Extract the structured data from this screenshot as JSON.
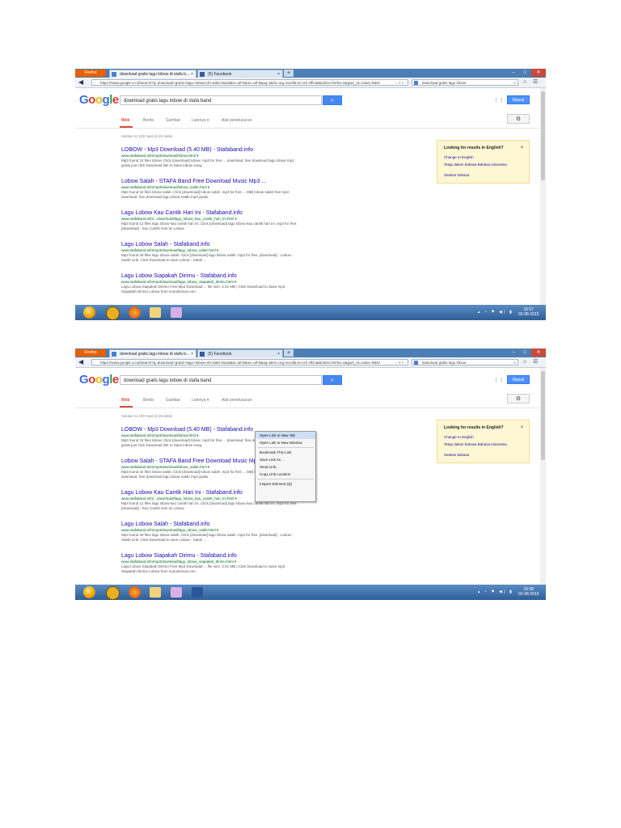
{
  "screens": [
    {
      "browser": {
        "firefox_label": "Firefox",
        "tabs": [
          {
            "label": "download gratis lagu lobow di stafa b...",
            "close": "×"
          },
          {
            "label": "(5) Facebook",
            "close": "×"
          }
        ],
        "new_tab": "+",
        "window_controls": {
          "minimize": "–",
          "maximize": "□",
          "close": "✕"
        },
        "url": "https://www.google.co.id/search?q=download+gratis+lagu+lobow+di+stafa+band&ie=utf-8&oe=utf-8&aq=t&rls=org.mozilla:en-US:official&client=firefox-a&gws_rd=cr&ei=R&IV",
        "search_text": "download gratis lagu lobow"
      },
      "google": {
        "query": "download gratis lagu lobow di stafa band",
        "masuk": "Masuk",
        "nav": [
          "Web",
          "Berita",
          "Gambar",
          "Lainnya ▾",
          "Alat penelusuran"
        ],
        "stats": "Sekitar 61.100 hasil (0,28 detik)",
        "results": [
          {
            "title": "LOBOW - Mp3 Download (5.40 MB) - Stafaband.info",
            "url": "www.stafaband.info/mp3/download/lobow.html ▾",
            "snippet": "Mp3 found 32 files lobow. Click [download] lobow .mp3 for free ... download, free download lagu lobow mp3 gratis.just click Download link to Save lobow song."
          },
          {
            "title": "Lobow Salah - STAFA Band Free Download Music Mp3 ...",
            "url": "www.stafaband.info/mp3/download/lobow_salah.html ▾",
            "snippet": "Mp3 found 32 files lobow salah. Click [download] lobow salah .mp3 for free ... MB] lobow salah free mp3 download, free download lagu lobow salah mp3 gratis."
          },
          {
            "title": "Lagu Lobow Kau Cantik Hari Ini - Stafaband.info",
            "url": "www.stafaband.info/.../download/lagu_lobow_kau_cantik_hari_ini.html ▾",
            "snippet": "Mp3 found 12 files lagu lobow kau cantik hari ini. Click [download] lagu lobow kau cantik hari ini .mp3 for free. [download] - Kau Cantik Hari Ini Lobow"
          },
          {
            "title": "Lagu Lobow Salah - Stafaband.info",
            "url": "www.stafaband.info/mp3/download/lagu_lobow_salah.html ▾",
            "snippet": "Mp3 found 29 files lagu lobow salah. Click [download] lagu lobow salah .mp3 for free. [download] - Lobow - Salah Lirik. Click Download to save Lobow - Salah ..."
          },
          {
            "title": "Lagu Lobow Siapakah Dirimu - Stafaband.info",
            "url": "www.stafaband.info/mp3/download/lagu_lobow_siapakah_dirimu.html ▾",
            "snippet": "Lagu Lobow Siapakah Dirimu Free Mp3 Download ... file size: 2.01 MB | Click Download to Save mp3 Siapakah Dirimu Lobow from soundcloud.com."
          }
        ],
        "lang_box": {
          "heading": "Looking for results in English?",
          "close": "✕",
          "links": [
            "Change to English",
            "Tetap dalam bahasa Bahasa Indonesia",
            "Setelan bahasa"
          ]
        }
      },
      "taskbar": {
        "time": "15:57",
        "date": "02-08-2015"
      }
    },
    {
      "browser": {
        "firefox_label": "Firefox",
        "tabs": [
          {
            "label": "download gratis lagu lobow di stafa b...",
            "close": "×"
          },
          {
            "label": "(5) Facebook",
            "close": "×"
          }
        ],
        "new_tab": "+",
        "window_controls": {
          "minimize": "–",
          "maximize": "□",
          "close": "✕"
        },
        "url": "https://www.google.co.id/search?q=download+gratis+lagu+lobow+di+stafa+band&ie=utf-8&oe=utf-8&aq=t&rls=org.mozilla:en-US:official&client=firefox-a&gws_rd=cr&ei=R&IV",
        "search_text": "download gratis lagu lobow"
      },
      "google": {
        "query": "download gratis lagu lobow di stafa band",
        "masuk": "Masuk",
        "nav": [
          "Web",
          "Berita",
          "Gambar",
          "Lainnya ▾",
          "Alat penelusuran"
        ],
        "stats": "Sekitar 61.100 hasil (0,28 detik)",
        "results": [
          {
            "title": "LOBOW - Mp3 Download (5.40 MB) - Stafaband.info",
            "url": "www.stafaband.info/mp3/download/lobow.html ▾",
            "snippet": "Mp3 found 32 files lobow. Click [download] lobow .mp3 for free ... download, free download lagu lobow mp3 gratis.just click Download link to Save lobow song."
          },
          {
            "title": "Lobow Salah - STAFA Band Free Download Music Mp3 ...",
            "url": "www.stafaband.info/mp3/download/lobow_salah.html ▾",
            "snippet": "Mp3 found 32 files lobow salah. Click [download] lobow salah .mp3 for free ... MB] lobow salah free mp3 download, free download lagu lobow salah mp3 gratis."
          },
          {
            "title": "Lagu Lobow Kau Cantik Hari Ini - Stafaband.info",
            "url": "www.stafaband.info/.../download/lagu_lobow_kau_cantik_hari_ini.html ▾",
            "snippet": "Mp3 found 12 files lagu lobow kau cantik hari ini. Click [download] lagu lobow kau cantik hari ini .mp3 for free. [download] - Kau Cantik Hari Ini Lobow"
          },
          {
            "title": "Lagu Lobow Salah - Stafaband.info",
            "url": "www.stafaband.info/mp3/download/lagu_lobow_salah.html ▾",
            "snippet": "Mp3 found 29 files lagu lobow salah. Click [download] lagu lobow salah .mp3 for free. [download] - Lobow - Salah Lirik. Click Download to save Lobow - Salah ..."
          },
          {
            "title": "Lagu Lobow Siapakah Dirimu - Stafaband.info",
            "url": "www.stafaband.info/mp3/download/lagu_lobow_siapakah_dirimu.html ▾",
            "snippet": "Lagu Lobow Siapakah Dirimu Free Mp3 Download ... file size: 2.01 MB | Click Download to Save mp3 Siapakah Dirimu Lobow from soundcloud.com."
          }
        ],
        "lang_box": {
          "heading": "Looking for results in English?",
          "close": "✕",
          "links": [
            "Change to English",
            "Tetap dalam bahasa Bahasa Indonesia",
            "Setelan bahasa"
          ]
        }
      },
      "context_menu": [
        "Open Link in New Tab",
        "Open Link in New Window",
        "Bookmark This Link",
        "Save Link As...",
        "Send Link...",
        "Copy Link Location",
        "Inspect Element (Q)"
      ],
      "taskbar": {
        "time": "15:58",
        "date": "02-08-2015"
      }
    }
  ],
  "colors": {
    "google_blue": "#4688f1",
    "link": "#1a0dab",
    "url_green": "#006621",
    "active_tab_red": "#dd4b39",
    "info_bg": "#fef7d3"
  }
}
